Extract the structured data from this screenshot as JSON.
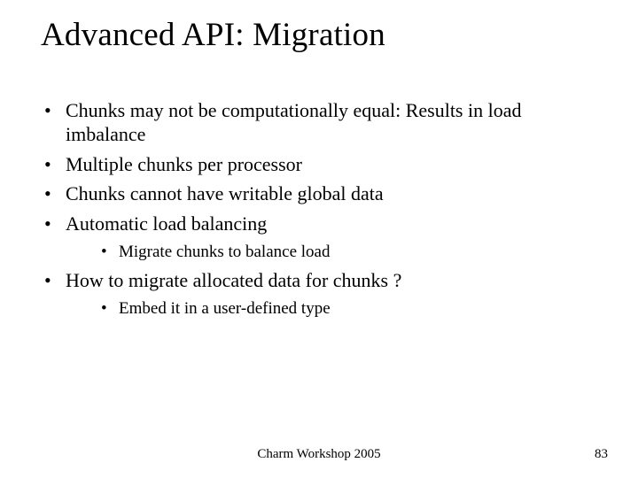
{
  "title": "Advanced API: Migration",
  "bullets": [
    {
      "text": "Chunks may not be computationally equal: Results in load imbalance"
    },
    {
      "text": "Multiple chunks per processor"
    },
    {
      "text": "Chunks cannot have writable global data"
    },
    {
      "text": "Automatic load balancing",
      "sub": [
        {
          "text": "Migrate chunks to balance load"
        }
      ]
    },
    {
      "text": "How to migrate allocated data for chunks ?",
      "sub": [
        {
          "text": "Embed it in a user-defined type"
        }
      ]
    }
  ],
  "footer": {
    "center": "Charm Workshop 2005",
    "page": "83"
  }
}
